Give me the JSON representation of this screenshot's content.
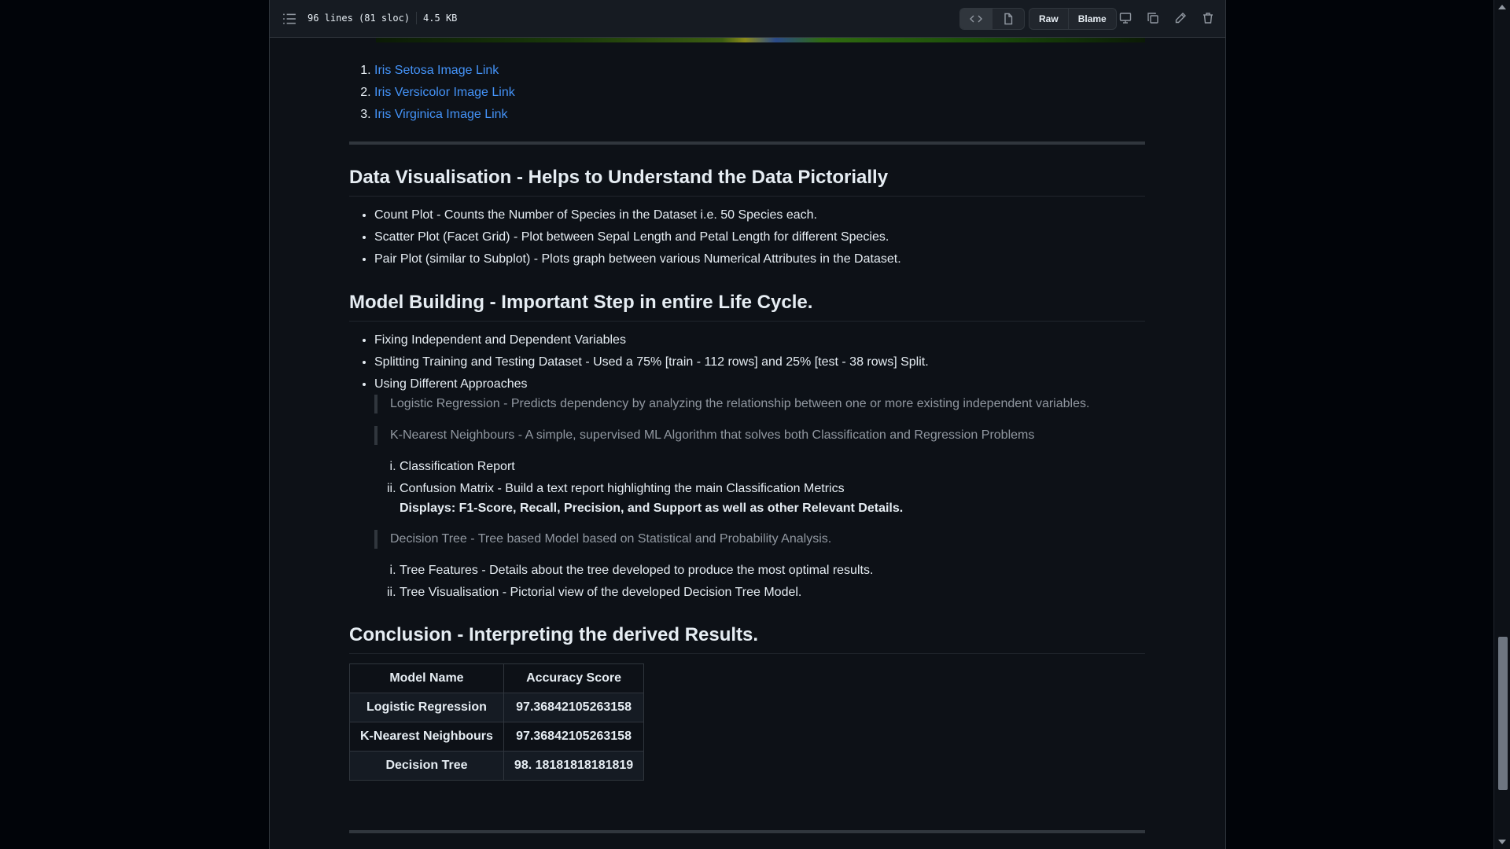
{
  "file_header": {
    "lines": "96 lines (81 sloc)",
    "size": "4.5 KB",
    "raw_label": "Raw",
    "blame_label": "Blame"
  },
  "image_links": [
    {
      "text": "Iris Setosa Image Link"
    },
    {
      "text": "Iris Versicolor Image Link"
    },
    {
      "text": "Iris Virginica Image Link"
    }
  ],
  "sections": {
    "data_vis": {
      "heading": "Data Visualisation - Helps to Understand the Data Pictorially",
      "items": [
        "Count Plot - Counts the Number of Species in the Dataset i.e. 50 Species each.",
        "Scatter Plot (Facet Grid) - Plot between Sepal Length and Petal Length for different Species.",
        "Pair Plot (similar to Subplot) - Plots graph between various Numerical Attributes in the Dataset."
      ]
    },
    "model": {
      "heading": "Model Building - Important Step in entire Life Cycle.",
      "items": [
        "Fixing Independent and Dependent Variables",
        "Splitting Training and Testing Dataset - Used a 75% [train - 112 rows] and 25% [test - 38 rows] Split.",
        "Using Different Approaches"
      ],
      "quote_lr": "Logistic Regression - Predicts dependency by analyzing the relationship between one or more existing independent variables.",
      "quote_knn": "K-Nearest Neighbours - A simple, supervised ML Algorithm that solves both Classification and Regression Problems",
      "knn_sub": [
        "Classification Report",
        "Confusion Matrix - Build a text report highlighting the main Classification Metrics"
      ],
      "knn_displays": "Displays: F1-Score, Recall, Precision, and Support as well as other Relevant Details.",
      "quote_dt": "Decision Tree - Tree based Model based on Statistical and Probability Analysis.",
      "dt_sub": [
        "Tree Features - Details about the tree developed to produce the most optimal results.",
        "Tree Visualisation - Pictorial view of the developed Decision Tree Model."
      ]
    },
    "conclusion": {
      "heading": "Conclusion - Interpreting the derived Results.",
      "table": {
        "headers": [
          "Model Name",
          "Accuracy Score"
        ],
        "rows": [
          [
            "Logistic Regression",
            "97.36842105263158"
          ],
          [
            "K-Nearest Neighbours",
            "97.36842105263158"
          ],
          [
            "Decision Tree",
            "98. 18181818181819"
          ]
        ]
      }
    }
  }
}
